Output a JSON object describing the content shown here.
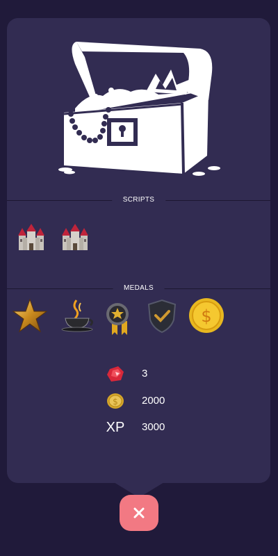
{
  "sections": {
    "scripts_label": "SCRIPTS",
    "medals_label": "MEDALS"
  },
  "scripts": [
    {
      "icon": "castle-icon"
    },
    {
      "icon": "castle-icon"
    }
  ],
  "medals": [
    {
      "icon": "gold-star-icon"
    },
    {
      "icon": "coffee-cup-icon"
    },
    {
      "icon": "star-ribbon-medal-icon"
    },
    {
      "icon": "shield-check-icon"
    },
    {
      "icon": "dollar-coin-icon"
    }
  ],
  "rewards": {
    "gems": {
      "icon": "red-gem-icon",
      "value": "3"
    },
    "coins": {
      "icon": "gold-coin-icon",
      "value": "2000"
    },
    "xp": {
      "label": "XP",
      "value": "3000"
    }
  },
  "close_button": {
    "icon": "close-icon"
  },
  "colors": {
    "background": "#201a3a",
    "card": "#322c52",
    "close_button": "#f27983",
    "text": "#ffffff"
  }
}
